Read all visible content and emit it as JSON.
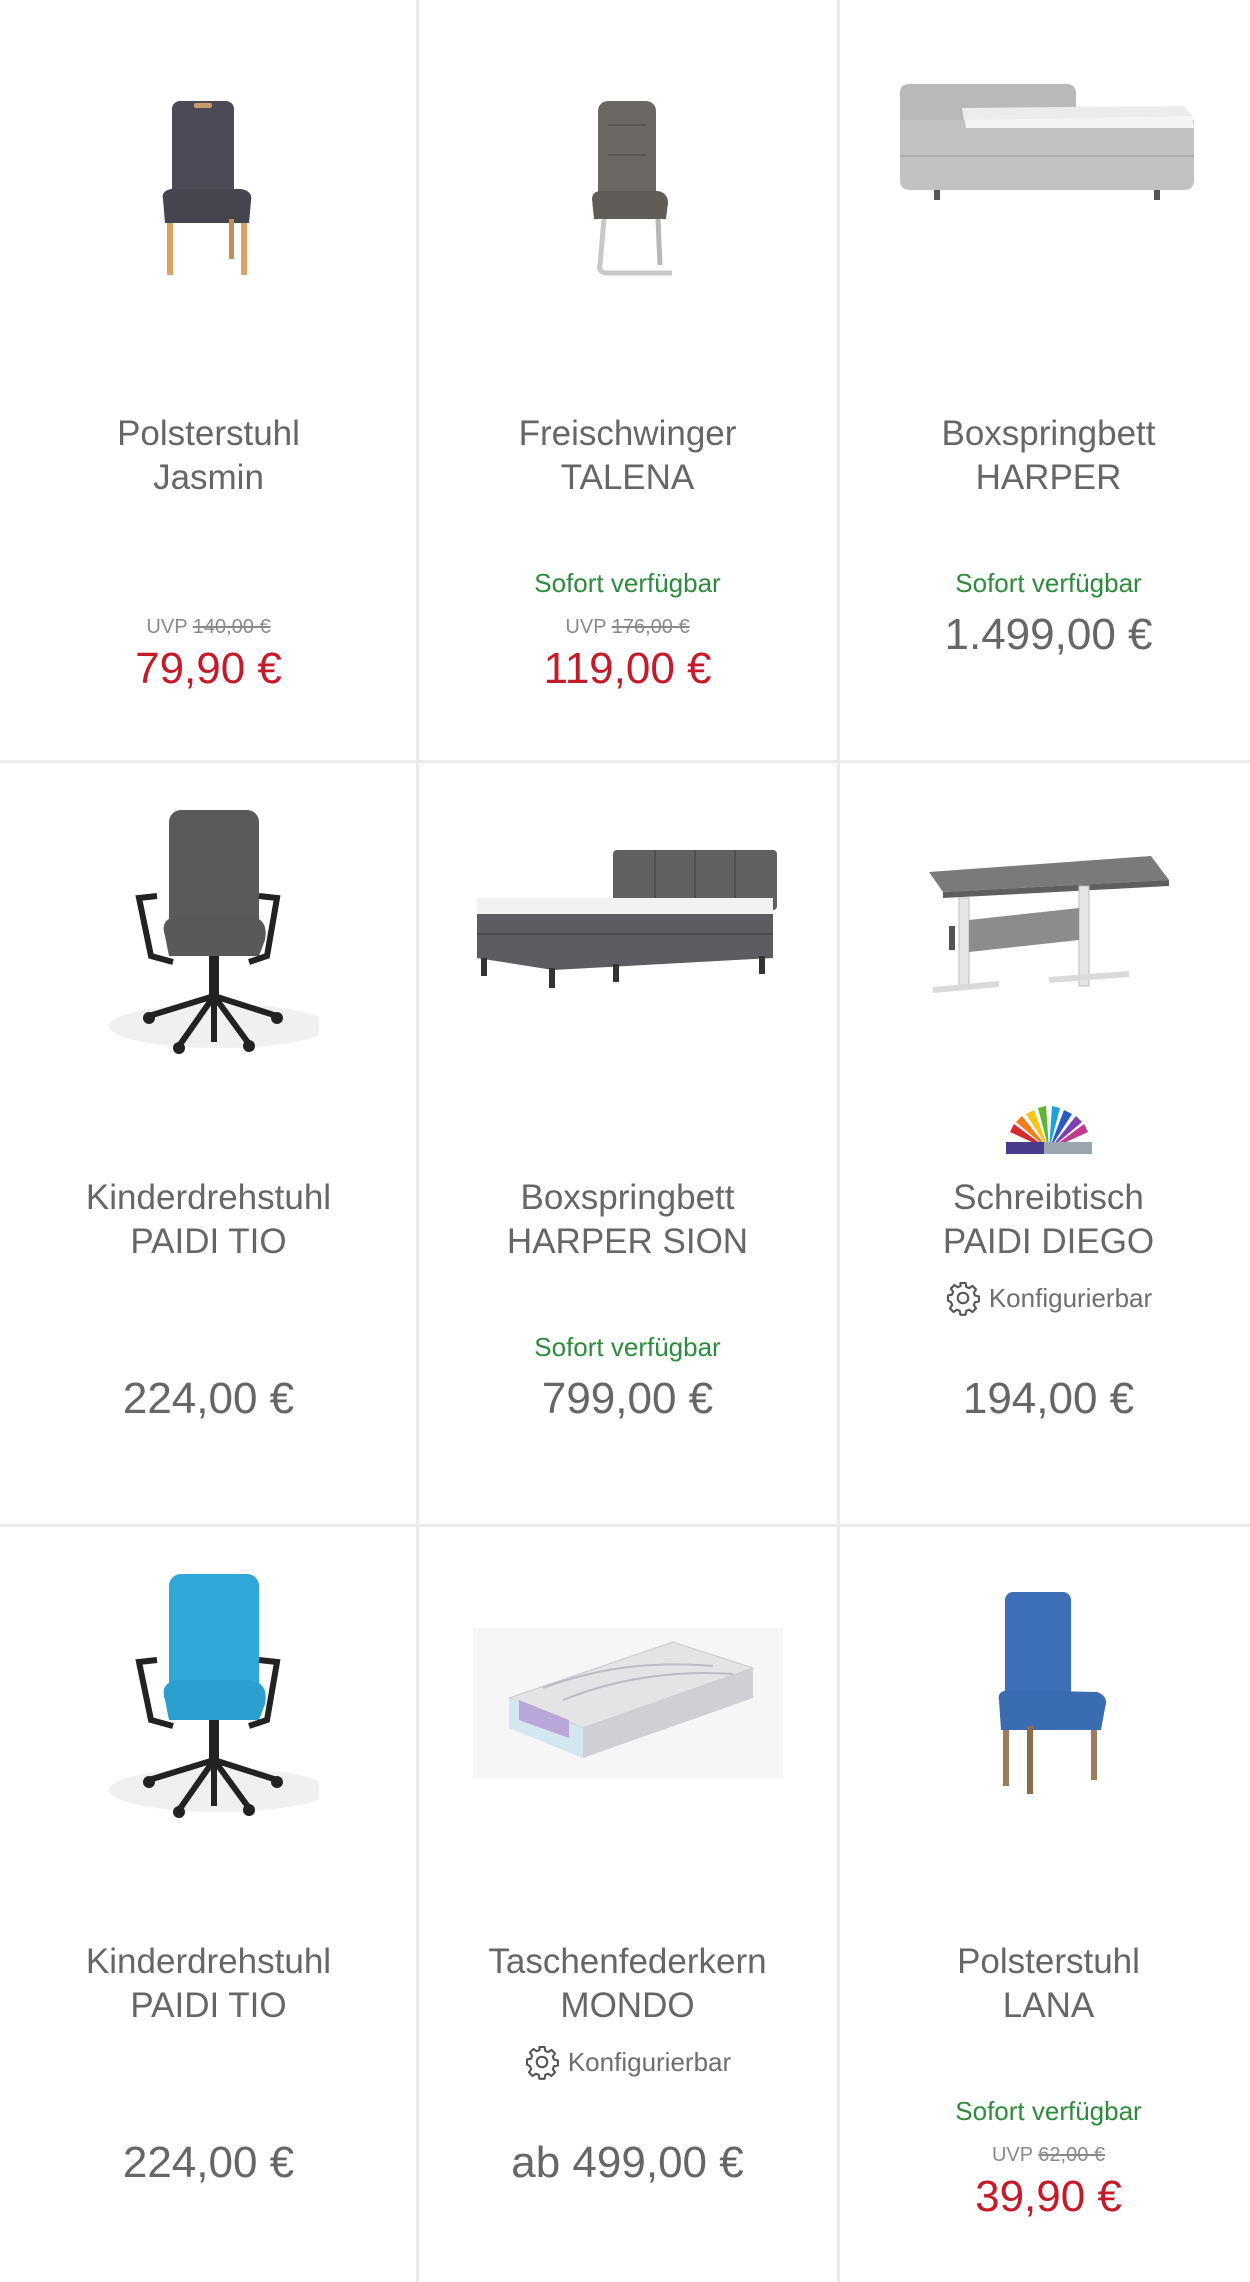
{
  "products": [
    {
      "title_line1": "Polsterstuhl",
      "title_line2": "Jasmin",
      "availability": "",
      "uvp_label": "UVP",
      "uvp_price": "140,00 €",
      "price": "79,90 €",
      "image_icon": "upholstered-chair-dark"
    },
    {
      "title_line1": "Freischwinger",
      "title_line2": "TALENA",
      "availability": "Sofort verfügbar",
      "uvp_label": "UVP",
      "uvp_price": "176,00 €",
      "price": "119,00 €",
      "image_icon": "cantilever-chair"
    },
    {
      "title_line1": "Boxspringbett",
      "title_line2": "HARPER",
      "availability": "Sofort verfügbar",
      "price": "1.499,00 €",
      "image_icon": "boxspring-bed-light"
    },
    {
      "title_line1": "Kinderdrehstuhl",
      "title_line2": "PAIDI TIO",
      "price": "224,00 €",
      "image_icon": "office-chair-grey"
    },
    {
      "title_line1": "Boxspringbett",
      "title_line2": "HARPER SION",
      "availability": "Sofort verfügbar",
      "price": "799,00 €",
      "image_icon": "boxspring-bed-dark"
    },
    {
      "title_line1": "Schreibtisch",
      "title_line2": "PAIDI DIEGO",
      "config_label": "Konfigurierbar",
      "price": "194,00 €",
      "image_icon": "desk"
    },
    {
      "title_line1": "Kinderdrehstuhl",
      "title_line2": "PAIDI TIO",
      "price": "224,00 €",
      "image_icon": "office-chair-blue"
    },
    {
      "title_line1": "Taschenfederkern",
      "title_line2": "MONDO",
      "config_label": "Konfigurierbar",
      "price": "ab 499,00 €",
      "image_icon": "mattress"
    },
    {
      "title_line1": "Polsterstuhl",
      "title_line2": "LANA",
      "availability": "Sofort verfügbar",
      "uvp_label": "UVP",
      "uvp_price": "62,00 €",
      "price": "39,90 €",
      "image_icon": "upholstered-chair-blue"
    }
  ],
  "colors": {
    "sale_price": "#c41b2b",
    "availability": "#2e8b3e",
    "text": "#666666",
    "divider": "#ebebeb"
  }
}
